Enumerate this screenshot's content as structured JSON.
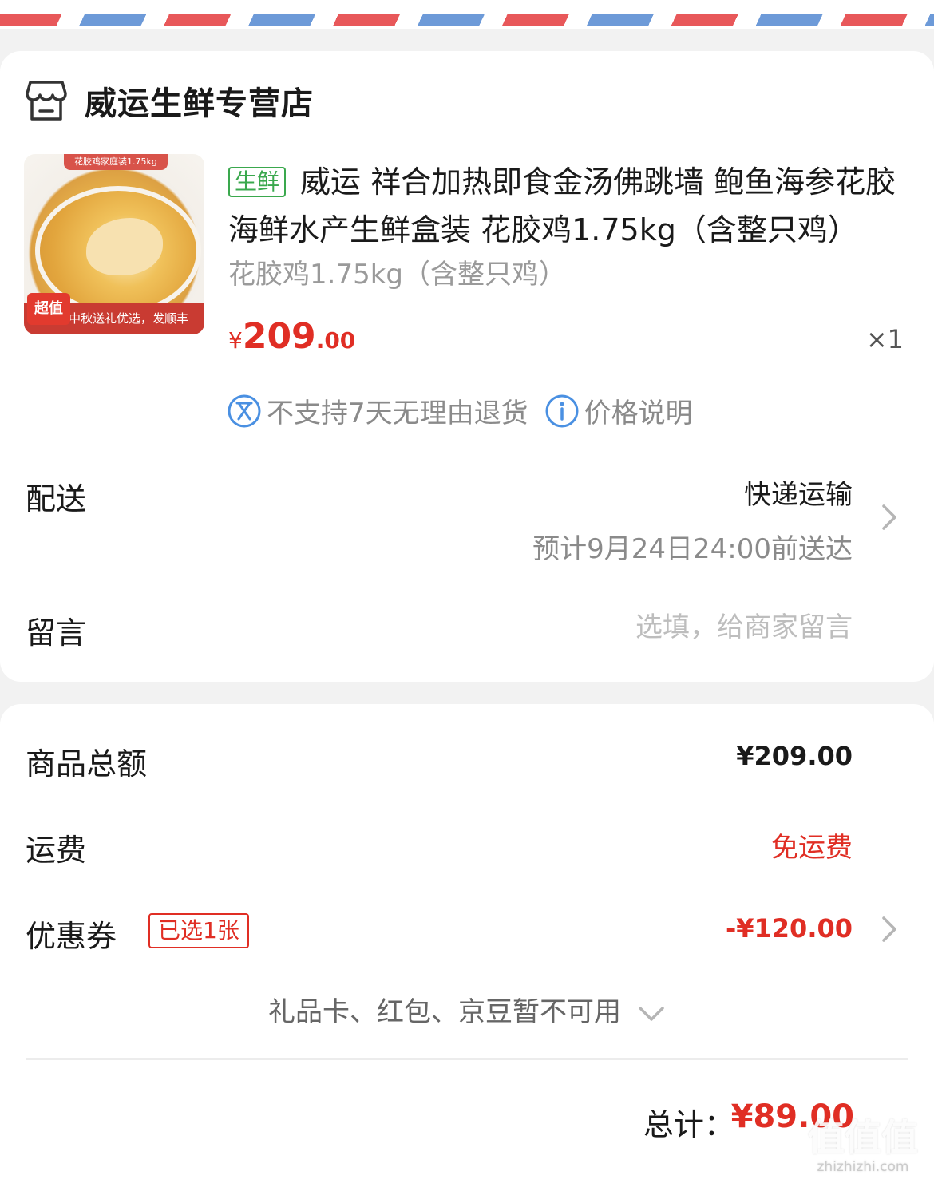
{
  "shop": {
    "name": "威运生鲜专营店",
    "icon": "store-icon"
  },
  "product": {
    "tag": "生鲜",
    "title": "威运 祥合加热即食金汤佛跳墙 鲍鱼海参花胶海鲜水产生鲜盒装 花胶鸡1.75kg（含整只鸡）",
    "spec": "花胶鸡1.75kg（含整只鸡）",
    "price_currency": "¥",
    "price_int": "209",
    "price_dec": ".00",
    "quantity": "×1",
    "image": {
      "top_label": "花胶鸡家庭装1.75kg",
      "badge": "超值",
      "band_text": "中秋送礼优选，发顺丰"
    },
    "notices": {
      "no_return": "不支持7天无理由退货",
      "price_info": "价格说明"
    }
  },
  "delivery": {
    "label": "配送",
    "method": "快递运输",
    "eta": "预计9月24日24:00前送达"
  },
  "message": {
    "label": "留言",
    "placeholder": "选填，给商家留言"
  },
  "summary": {
    "subtotal_label": "商品总额",
    "subtotal_value": "¥209.00",
    "shipping_label": "运费",
    "shipping_value": "免运费",
    "coupon_label": "优惠券",
    "coupon_badge": "已选1张",
    "coupon_value": "-¥120.00",
    "unavailable": "礼品卡、红包、京豆暂不可用",
    "total_label": "总计：",
    "total_value": "¥89.00"
  },
  "watermark": {
    "text": "值值值",
    "site": "zhizhizhi.com"
  },
  "colors": {
    "accent_red": "#e02e24",
    "fresh_green": "#3aa84d",
    "info_blue": "#4a90e2",
    "airmail_red": "#e8585a",
    "airmail_blue": "#6d9ad8"
  }
}
